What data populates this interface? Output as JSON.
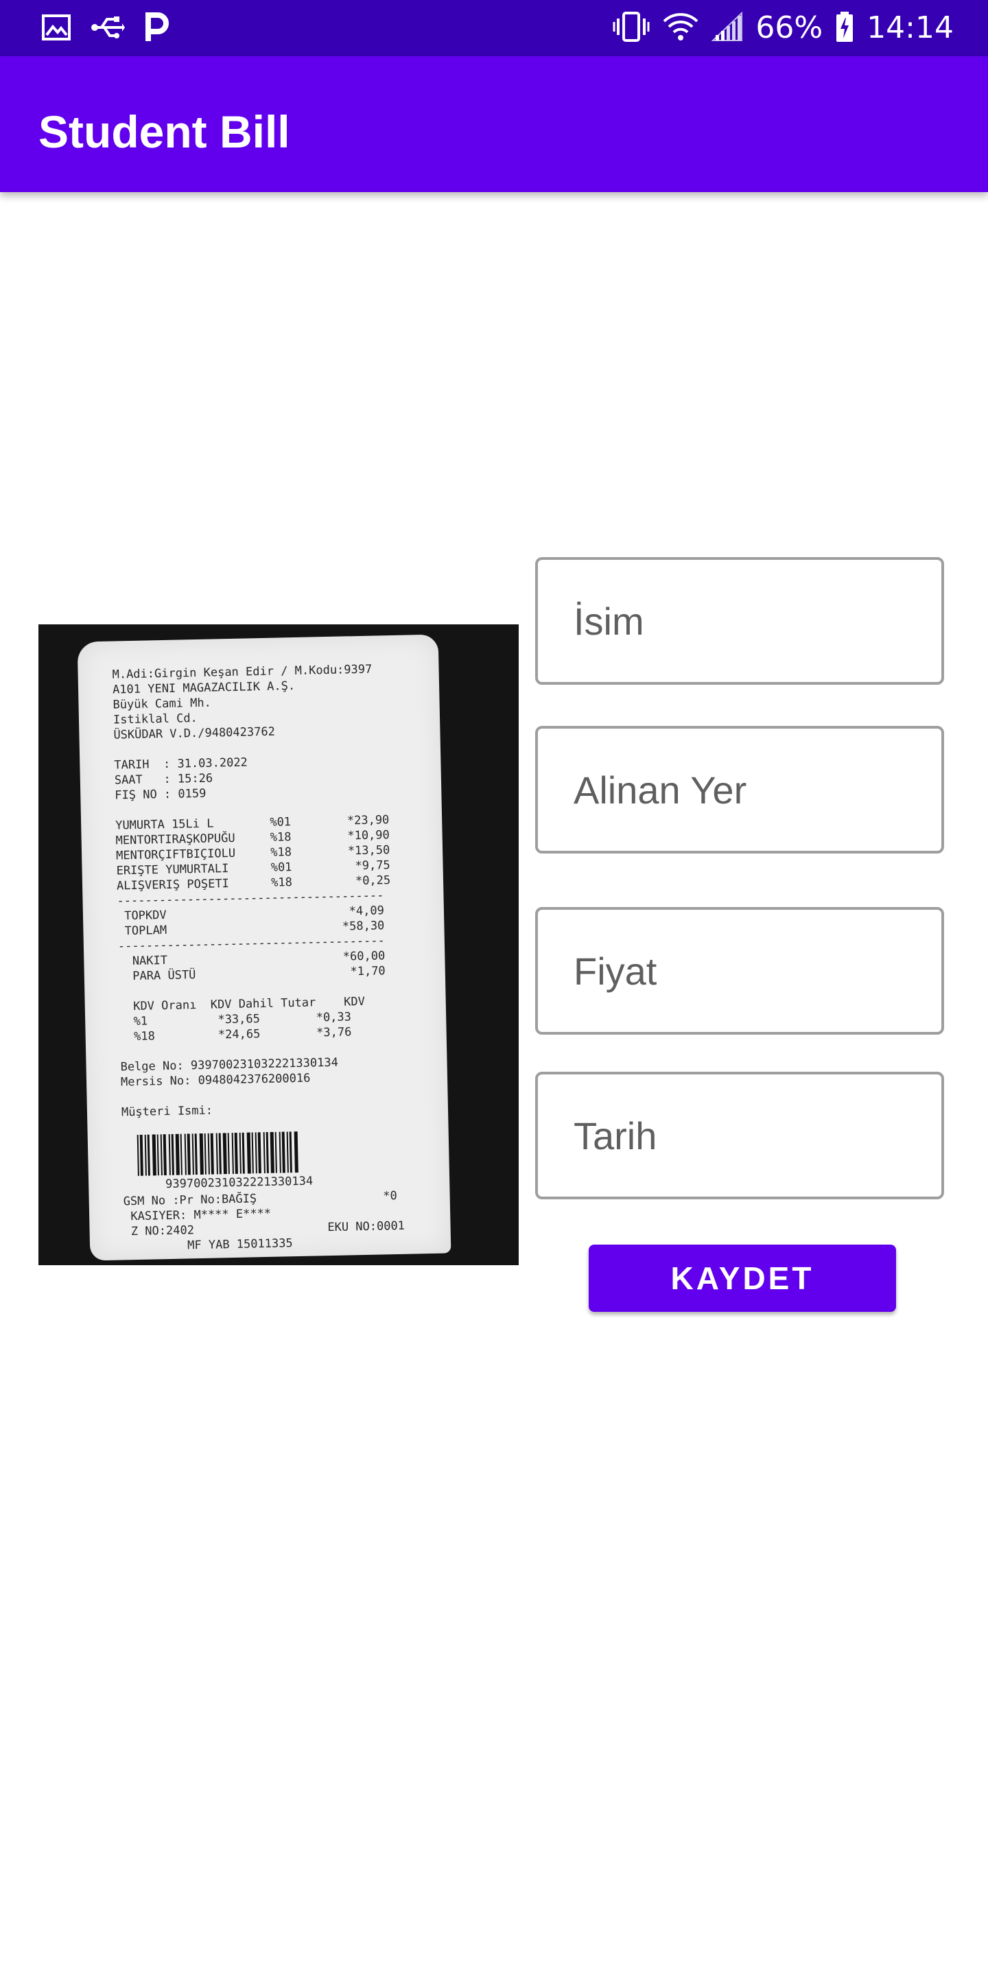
{
  "status_bar": {
    "battery_percent": "66%",
    "time": "14:14",
    "left_icons": [
      "image-icon",
      "usb-icon",
      "parking-icon"
    ],
    "right_icons": [
      "vibrate-icon",
      "wifi-icon",
      "signal-icon",
      "battery-charging-icon"
    ]
  },
  "app_bar": {
    "title": "Student Bill"
  },
  "receipt_image": {
    "icon": "receipt-photo",
    "lines": [
      "M.Adi:Girgin Keşan Edir / M.Kodu:9397",
      "A101 YENI MAGAZACILIK A.Ş.",
      "Büyük Cami Mh.",
      "Istiklal Cd.",
      "ÜSKÜDAR V.D./9480423762",
      "",
      "TARIH  : 31.03.2022",
      "SAAT   : 15:26",
      "FIŞ NO : 0159",
      "",
      "YUMURTA 15Li L        %01        *23,90",
      "MENTORTIRAŞKOPUĞU     %18        *10,90",
      "MENTORÇIFTBIÇIOLU     %18        *13,50",
      "ERIŞTE YUMURTALI      %01         *9,75",
      "ALIŞVERIŞ POŞETI      %18         *0,25",
      "--------------------------------------",
      " TOPKDV                          *4,09",
      " TOPLAM                         *58,30",
      "--------------------------------------",
      "  NAKIT                         *60,00",
      "  PARA ÜSTÜ                      *1,70",
      "",
      "  KDV Oranı  KDV Dahil Tutar    KDV",
      "  %1          *33,65        *0,33",
      "  %18         *24,65        *3,76",
      "",
      "Belge No: 939700231032221330134",
      "Mersis No: 0948042376200016",
      "",
      "Müşteri Ismi:"
    ],
    "barcode_number": "939700231032221330134",
    "footer_lines": [
      "GSM No :Pr No:BAĞIŞ                  *0",
      " KASIYER: M**** E****",
      " Z NO:2402                   EKU NO:0001",
      "         MF YAB 15011335"
    ]
  },
  "form": {
    "name_placeholder": "İsim",
    "place_placeholder": "Alinan Yer",
    "price_placeholder": "Fiyat",
    "date_placeholder": "Tarih",
    "save_label": "KAYDET"
  }
}
